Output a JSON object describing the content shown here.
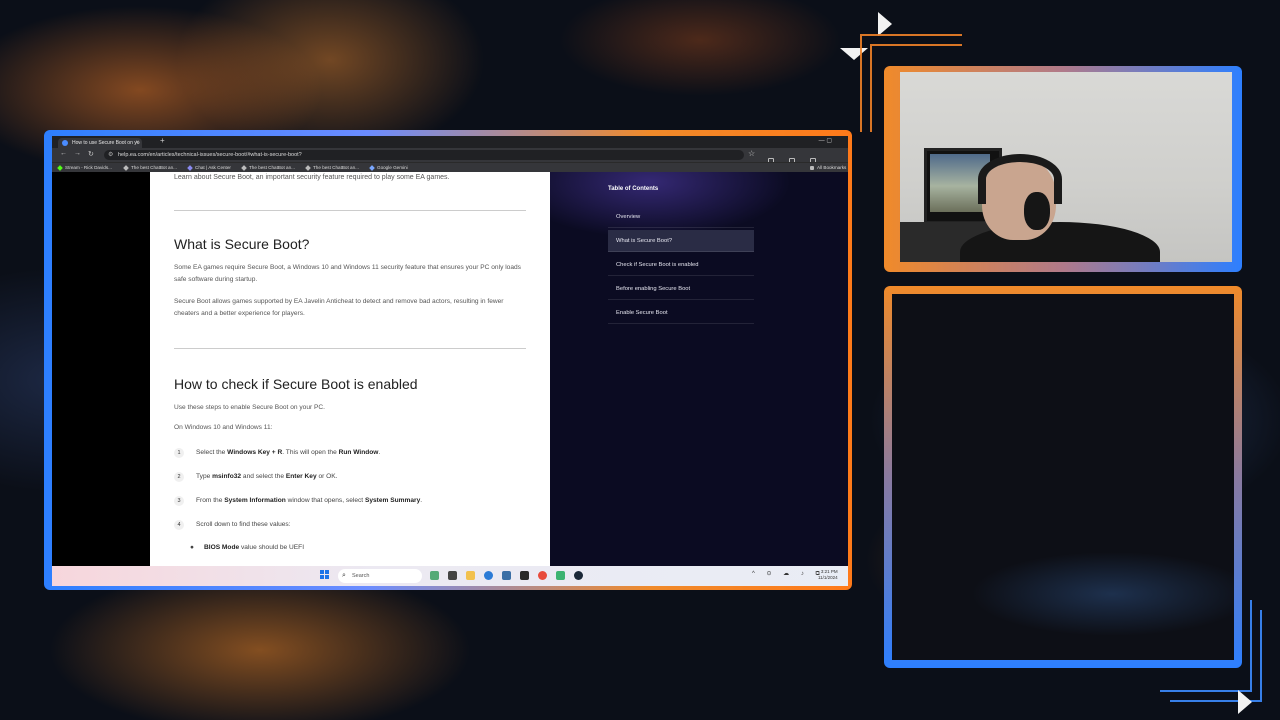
{
  "browser": {
    "tab_title": "How to use Secure Boot on yo",
    "new_tab": "+",
    "url": "help.ea.com/en/articles/technical-issues/secure-boot/#what-is-secure-boot?",
    "bookmarks": [
      "Stream - Rick Davids...",
      "The best ChatBot an...",
      "Chat | Ask Center",
      "The best ChatBot an...",
      "The best ChatBot an...",
      "Google Gemini"
    ],
    "all_bookmarks": "All Bookmarks"
  },
  "article": {
    "intro": "Learn about Secure Boot, an important security feature required to play some EA games.",
    "section1_title": "What is Secure Boot?",
    "section1_p1": "Some EA games require Secure Boot, a Windows 10 and Windows 11 security feature that ensures your PC only loads safe software during startup.",
    "section1_p2": "Secure Boot allows games supported by EA Javelin Anticheat to detect and remove bad actors, resulting in fewer cheaters and a better experience for players.",
    "section2_title": "How to check if Secure Boot is enabled",
    "section2_p1": "Use these steps to enable Secure Boot on your PC.",
    "section2_p2": "On Windows 10 and Windows 11:",
    "steps": [
      {
        "num": "1",
        "pre": "Select the ",
        "b1": "Windows Key + R",
        "mid": ". This will open the ",
        "b2": "Run Window",
        "post": "."
      },
      {
        "num": "2",
        "pre": "Type ",
        "b1": "msinfo32",
        "mid": " and select the ",
        "b2": "Enter Key",
        "post": " or OK."
      },
      {
        "num": "3",
        "pre": "From the ",
        "b1": "System Information",
        "mid": " window that opens, select ",
        "b2": "System Summary",
        "post": "."
      },
      {
        "num": "4",
        "pre": "Scroll down to find these values:",
        "b1": "",
        "mid": "",
        "b2": "",
        "post": ""
      }
    ],
    "bullet_label": "BIOS Mode",
    "bullet_text": " value should be UEFI"
  },
  "toc": {
    "title": "Table of Contents",
    "items": [
      "Overview",
      "What is Secure Boot?",
      "Check if Secure Boot is enabled",
      "Before enabling Secure Boot",
      "Enable Secure Boot"
    ],
    "active_index": 1
  },
  "taskbar": {
    "search_placeholder": "Search",
    "time": "3:21 PM",
    "date": "11/1/2024"
  }
}
